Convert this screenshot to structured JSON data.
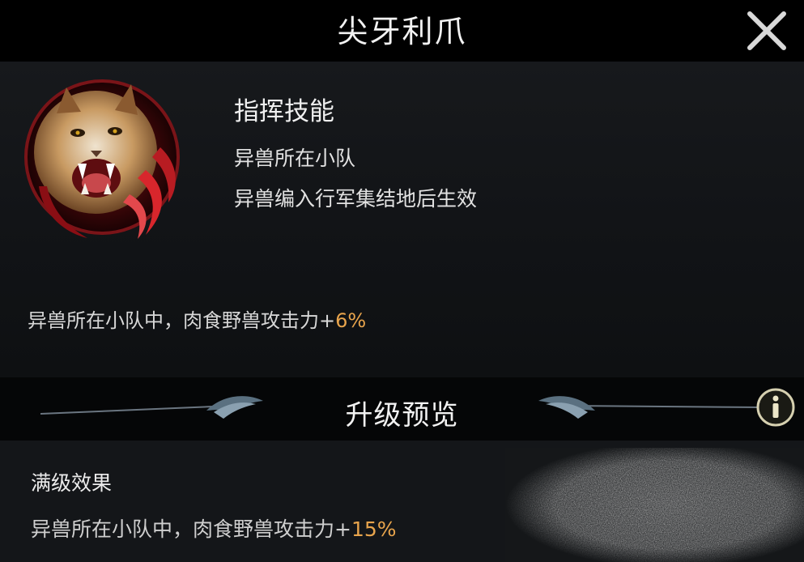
{
  "header": {
    "title": "尖牙利爪",
    "close_icon": "close-x-icon"
  },
  "skill": {
    "icon": "snarling-caracal-skill-icon",
    "type_label": "指挥技能",
    "condition_1": "异兽所在小队",
    "condition_2": "异兽编入行军集结地后生效",
    "current_effect_text": "异兽所在小队中，肉食野兽攻击力+",
    "current_effect_value": "6%"
  },
  "upgrade_preview": {
    "title": "升级预览",
    "info_icon": "info-icon",
    "max_level_label": "满级效果",
    "max_effect_text": "异兽所在小队中，肉食野兽攻击力+",
    "max_effect_value": "15%"
  },
  "colors": {
    "highlight": "#e8a44c",
    "background": "#0b0c0e",
    "panel": "#15171a"
  }
}
